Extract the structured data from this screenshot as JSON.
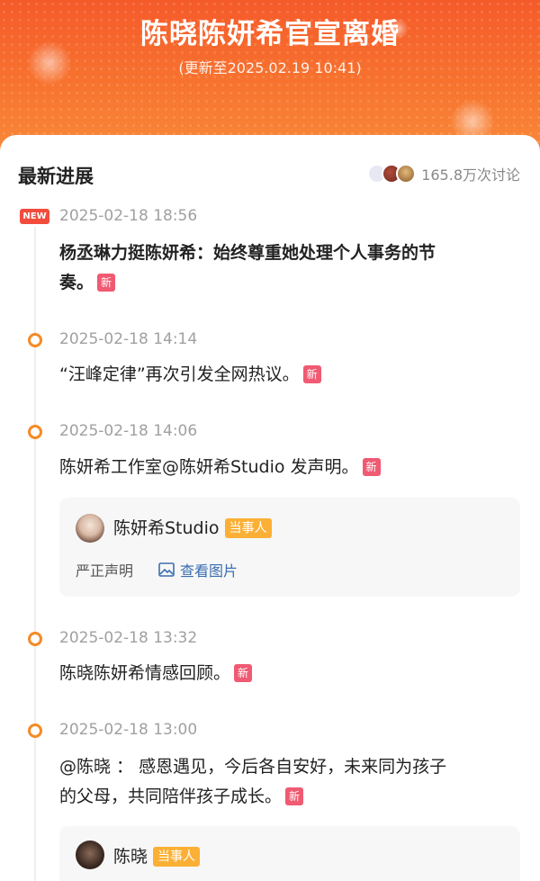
{
  "header": {
    "title": "陈晓陈妍希官宣离婚",
    "subtitle": "(更新至2025.02.19 10:41)"
  },
  "section": {
    "title": "最新进展",
    "discussion_count": "165.8万次讨论"
  },
  "badges": {
    "new_label": "NEW",
    "xin_label": "新"
  },
  "timeline": [
    {
      "time": "2025-02-18 18:56",
      "text_line1": "杨丞琳力挺陈妍希：始终尊重她处理个人事务的节",
      "text_line2": "奏。"
    },
    {
      "time": "2025-02-18 14:14",
      "text": "“汪峰定律”再次引发全网热议。"
    },
    {
      "time": "2025-02-18 14:06",
      "text": "陈妍希工作室@陈妍希Studio 发声明。",
      "card": {
        "name": "陈妍希Studio",
        "tag": "当事人",
        "desc": "严正声明",
        "view_label": "查看图片"
      }
    },
    {
      "time": "2025-02-18 13:32",
      "text": "陈晓陈妍希情感回顾。"
    },
    {
      "time": "2025-02-18 13:00",
      "text_line1": "@陈晓 ： 感恩遇见，今后各自安好，未来同为孩子",
      "text_line2": "的父母，共同陪伴孩子成长。",
      "card": {
        "name": "陈晓",
        "tag": "当事人"
      }
    }
  ],
  "colors": {
    "header_orange": "#f7742f",
    "timeline_dot": "#f58a25",
    "new_badge": "#f24c3d",
    "xin_badge": "#f05a72",
    "tag": "#fbb035",
    "link": "#3a6eb0"
  }
}
